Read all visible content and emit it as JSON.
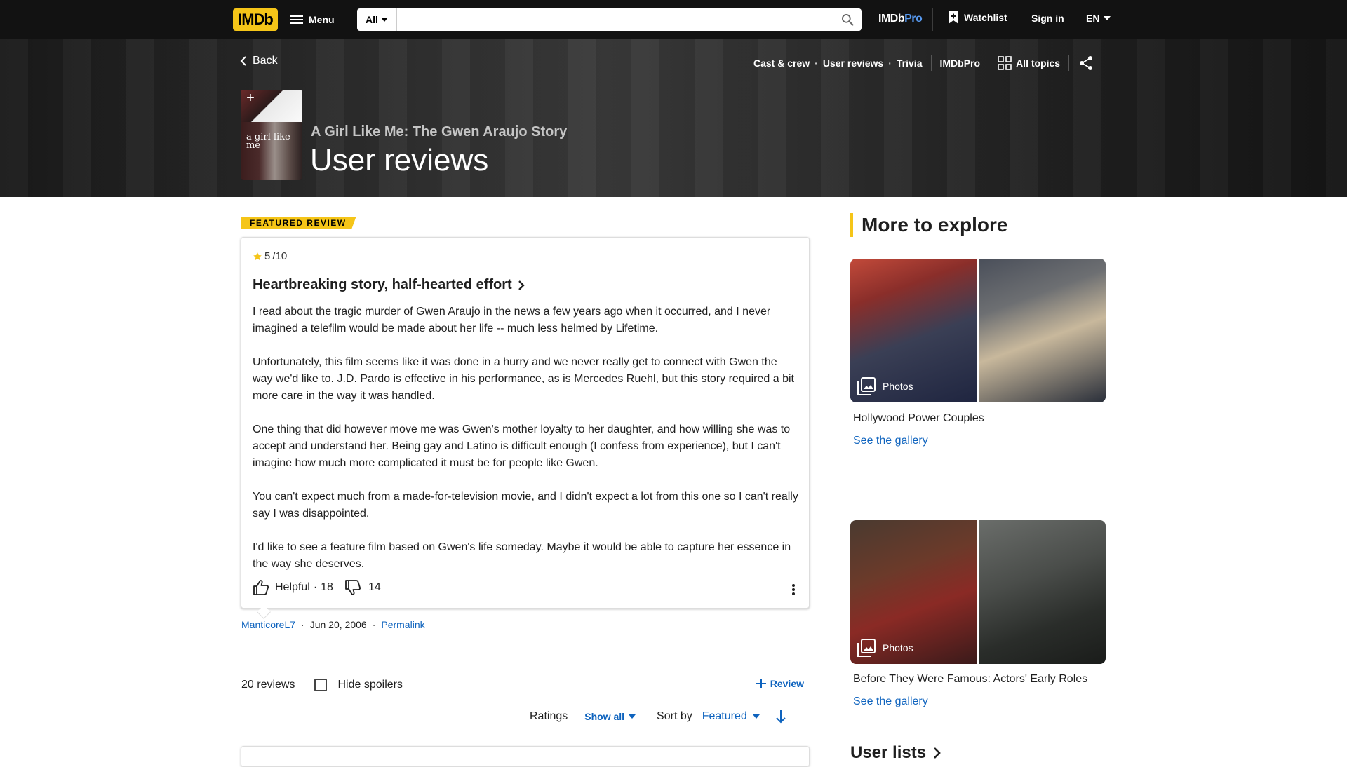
{
  "header": {
    "logo_text": "IMDb",
    "menu_label": "Menu",
    "search_category": "All",
    "search_placeholder": "",
    "pro_logo_prefix": "IMDb",
    "pro_logo_suffix": "Pro",
    "watchlist_label": "Watchlist",
    "signin_label": "Sign in",
    "language": "EN",
    "accent_color": "#f5c518"
  },
  "hero": {
    "back_label": "Back",
    "subnav": [
      "Cast & crew",
      "User reviews",
      "Trivia"
    ],
    "imdbpro_label": "IMDbPro",
    "all_topics_label": "All topics",
    "poster_text": "a girl like me",
    "movie_title": "A Girl Like Me: The Gwen Araujo Story",
    "page_title": "User reviews"
  },
  "featured": {
    "badge": "FEATURED REVIEW",
    "rating": "5",
    "rating_max": "/10",
    "title": "Heartbreaking story, half-hearted effort",
    "paragraphs": [
      "I read about the tragic murder of Gwen Araujo in the news a few years ago when it occurred, and I never imagined a telefilm would be made about her life -- much less helmed by Lifetime.",
      "Unfortunately, this film seems like it was done in a hurry and we never really get to connect with Gwen the way we'd like to. J.D. Pardo is effective in his performance, as is Mercedes Ruehl, but this story required a bit more care in the way it was handled.",
      "One thing that did however move me was Gwen's mother loyalty to her daughter, and how willing she was to accept and understand her. Being gay and Latino is difficult enough (I confess from experience), but I can't imagine how much more complicated it must be for people like Gwen.",
      "You can't expect much from a made-for-television movie, and I didn't expect a lot from this one so I can't really say I was disappointed.",
      "I'd like to see a feature film based on Gwen's life someday. Maybe it would be able to capture her essence in the way she deserves."
    ],
    "helpful_label": "Helpful",
    "helpful_count": "18",
    "unhelpful_count": "14",
    "author": "ManticoreL7",
    "date": "Jun 20, 2006",
    "permalink_label": "Permalink"
  },
  "reviews_bar": {
    "count_label": "20 reviews",
    "hide_spoilers_label": "Hide spoilers",
    "add_review_label": "Review",
    "ratings_label": "Ratings",
    "ratings_value": "Show all",
    "sort_label": "Sort by",
    "sort_value": "Featured"
  },
  "sidebar": {
    "title": "More to explore",
    "galleries": [
      {
        "photo_label": "Photos",
        "caption": "Hollywood Power Couples",
        "link": "See the gallery"
      },
      {
        "photo_label": "Photos",
        "caption": "Before They Were Famous: Actors' Early Roles",
        "link": "See the gallery"
      }
    ],
    "user_lists_label": "User lists"
  }
}
